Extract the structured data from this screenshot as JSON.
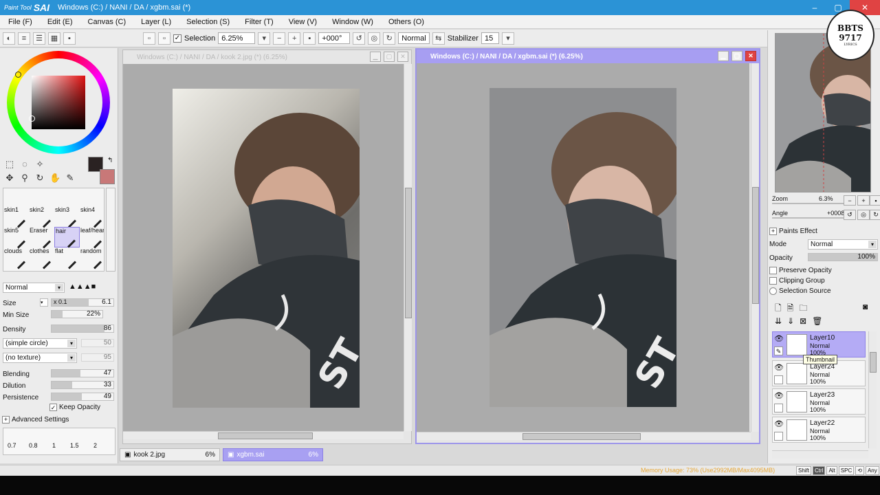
{
  "app": {
    "logo_small": "Paint Tool",
    "logo_big": "SAI",
    "title": "Windows (C:) / NANI / DA / xgbm.sai (*)"
  },
  "window_controls": {
    "minimize": "–",
    "maximize": "▢",
    "close": "✕"
  },
  "menu": [
    "File (F)",
    "Edit (E)",
    "Canvas (C)",
    "Layer (L)",
    "Selection (S)",
    "Filter (T)",
    "View (V)",
    "Window (W)",
    "Others (O)"
  ],
  "toolbar": {
    "selection_label": "Selection",
    "selection_checked": "✓",
    "zoom": "6.25%",
    "rotation": "+000°",
    "blend_mode": "Normal",
    "stabilizer_label": "Stabilizer",
    "stabilizer_value": "15"
  },
  "color": {
    "primary": "#2a2222",
    "secondary": "#c87878"
  },
  "brushes": [
    {
      "name": "skin1"
    },
    {
      "name": "skin2"
    },
    {
      "name": "skin3"
    },
    {
      "name": "skin4"
    },
    {
      "name": "skin5"
    },
    {
      "name": "Eraser"
    },
    {
      "name": "hair",
      "selected": true
    },
    {
      "name": "leaf/hear"
    },
    {
      "name": "clouds"
    },
    {
      "name": "clothes"
    },
    {
      "name": "flat"
    },
    {
      "name": "random"
    }
  ],
  "brush_props": {
    "mode": "Normal",
    "size_label": "Size",
    "size_mult": "x 0.1",
    "size_value": "6.1",
    "minsize_label": "Min Size",
    "minsize_value": "22%",
    "density_label": "Density",
    "density_value": "86",
    "shape": "(simple circle)",
    "shape_value": "50",
    "texture": "(no texture)",
    "texture_value": "95",
    "blending_label": "Blending",
    "blending_value": "47",
    "dilution_label": "Dilution",
    "dilution_value": "33",
    "persistence_label": "Persistence",
    "persistence_value": "49",
    "keep_opacity_label": "Keep Opacity",
    "keep_opacity_checked": "✓",
    "advanced_label": "Advanced Settings"
  },
  "ruler_labels": [
    "0.7",
    "0.8",
    "1",
    "1.5",
    "2"
  ],
  "canvas1": {
    "title": "Windows (C:) / NANI / DA / kook 2.jpg (*) (6.25%)"
  },
  "canvas2": {
    "title": "Windows (C:) / NANI / DA / xgbm.sai (*) (6.25%)"
  },
  "doc_tabs": [
    {
      "name": "kook 2.jpg",
      "pct": "6%"
    },
    {
      "name": "xgbm.sai",
      "pct": "6%",
      "active": true
    }
  ],
  "status": {
    "memory": "Memory Usage: 73% (Use2992MB/Max4095MB)",
    "keys": [
      "Shift",
      "Ctrl",
      "Alt",
      "SPC",
      "⟲",
      "Any",
      "✎"
    ]
  },
  "navigator": {
    "zoom_label": "Zoom",
    "zoom_value": "6.3%",
    "angle_label": "Angle",
    "angle_value": "+0008"
  },
  "layer_panel": {
    "paints_effect": "Paints Effect",
    "mode_label": "Mode",
    "mode_value": "Normal",
    "opacity_label": "Opacity",
    "opacity_value": "100%",
    "preserve_opacity": "Preserve Opacity",
    "clipping_group": "Clipping Group",
    "selection_source": "Selection Source",
    "tooltip": "Thumbnail",
    "layers": [
      {
        "name": "Layer10",
        "mode": "Normal",
        "opacity": "100%",
        "active": true
      },
      {
        "name": "Layer24",
        "mode": "Normal",
        "opacity": "100%"
      },
      {
        "name": "Layer23",
        "mode": "Normal",
        "opacity": "100%"
      },
      {
        "name": "Layer22",
        "mode": "Normal",
        "opacity": "100%"
      }
    ]
  },
  "watermark": {
    "line1": "BBTS",
    "line2": "9717",
    "line3": "LYRICS"
  }
}
